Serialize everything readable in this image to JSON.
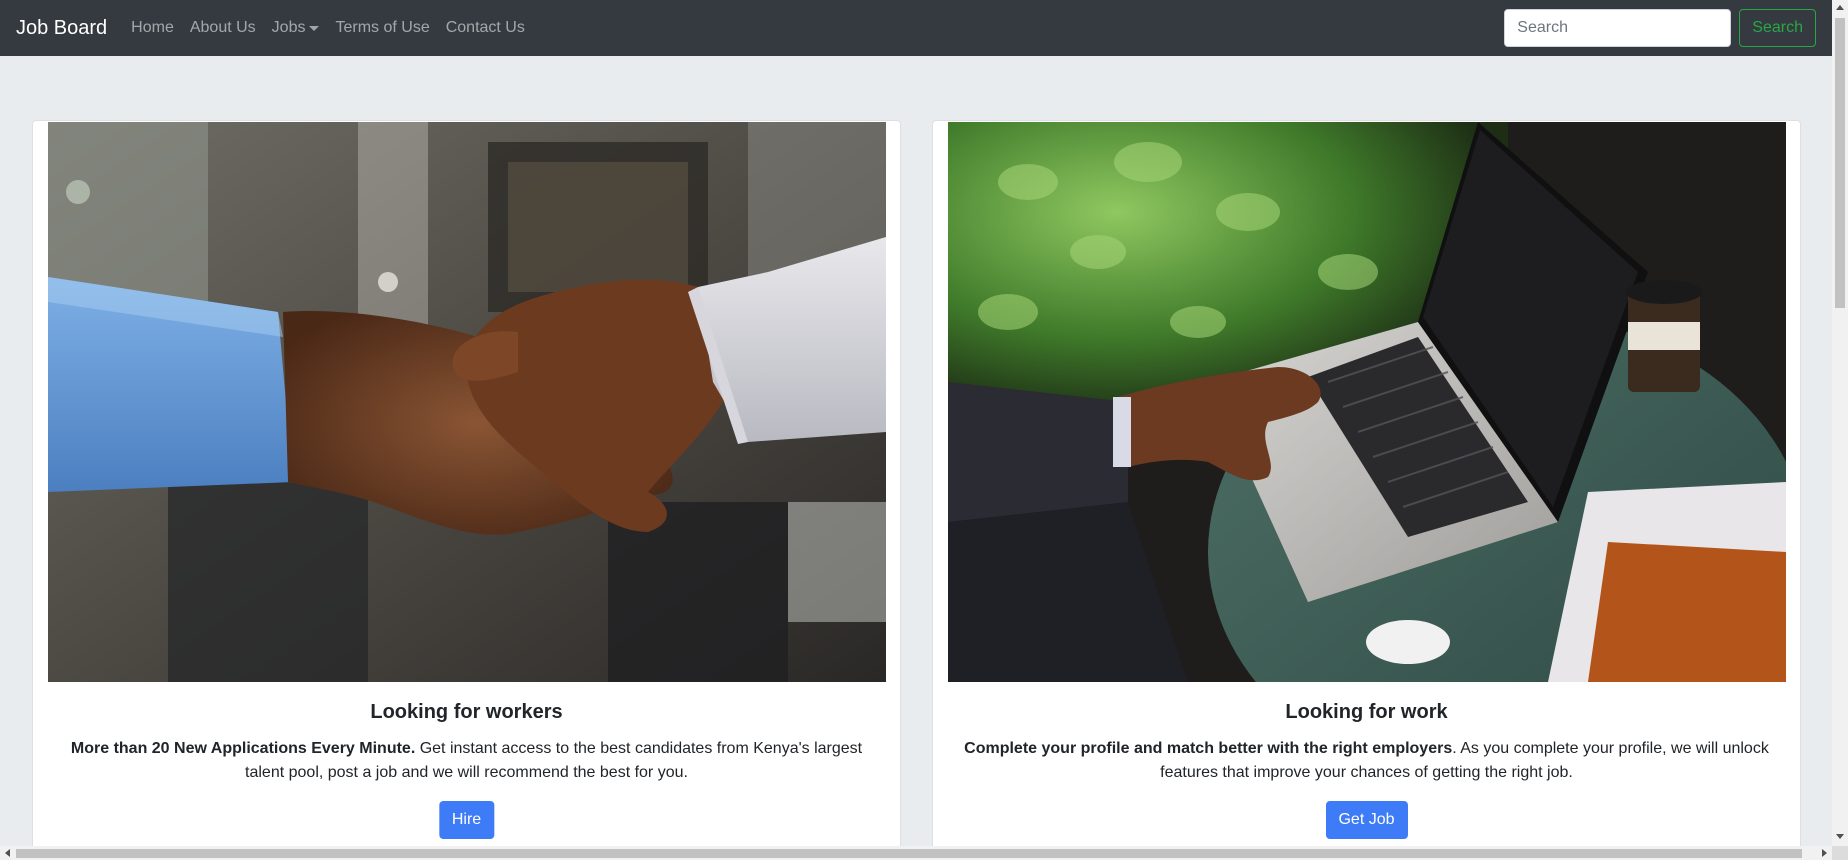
{
  "navbar": {
    "brand": "Job Board",
    "links": [
      "Home",
      "About Us",
      "Jobs",
      "Terms of Use",
      "Contact Us"
    ],
    "search_placeholder": "Search",
    "search_button": "Search"
  },
  "cards": [
    {
      "title": "Looking for workers",
      "text_bold": "More than 20 New Applications Every Minute.",
      "text_rest": " Get instant access to the best candidates from Kenya's largest talent pool, post a job and we will recommend the best for you.",
      "button": "Hire",
      "image": "handshake-photo"
    },
    {
      "title": "Looking for work",
      "text_bold": "Complete your profile and match better with the right employers",
      "text_rest": ". As you complete your profile, we will unlock features that improve your chances of getting the right job.",
      "button": "Get Job",
      "image": "laptop-photo"
    }
  ],
  "colors": {
    "navbar_bg": "#343a40",
    "page_bg": "#e9ecef",
    "primary_button": "#3d7bf7",
    "search_button": "#28a745"
  }
}
